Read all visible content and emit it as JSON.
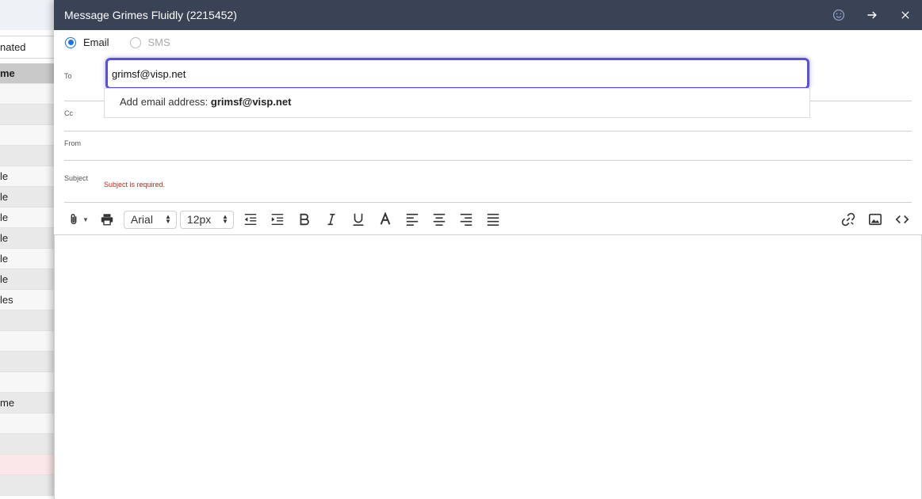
{
  "background": {
    "tab_label": "nated",
    "header_label": "me",
    "rows": [
      {
        "text": "",
        "style": "white"
      },
      {
        "text": "",
        "style": "gray"
      },
      {
        "text": "",
        "style": "white"
      },
      {
        "text": "",
        "style": "gray"
      },
      {
        "text": "le",
        "style": "white"
      },
      {
        "text": "le",
        "style": "gray"
      },
      {
        "text": "le",
        "style": "white"
      },
      {
        "text": "le",
        "style": "gray"
      },
      {
        "text": "le",
        "style": "white"
      },
      {
        "text": "le",
        "style": "gray"
      },
      {
        "text": "les",
        "style": "white"
      },
      {
        "text": "",
        "style": "gray"
      },
      {
        "text": "",
        "style": "white"
      },
      {
        "text": "",
        "style": "gray"
      },
      {
        "text": "",
        "style": "white"
      },
      {
        "text": "me",
        "style": "gray"
      },
      {
        "text": "",
        "style": "white"
      },
      {
        "text": "",
        "style": "gray"
      },
      {
        "text": "",
        "style": "pink"
      },
      {
        "text": "",
        "style": "gray"
      }
    ]
  },
  "dialog": {
    "title": "Message Grimes Fluidly (2215452)",
    "channel": {
      "email_label": "Email",
      "sms_label": "SMS",
      "selected": "Email"
    },
    "fields": {
      "to_label": "To",
      "to_value": "grimsf@visp.net",
      "cc_label": "Cc",
      "from_label": "From",
      "subject_label": "Subject",
      "subject_error": "Subject is required."
    },
    "suggestion": {
      "prefix": "Add email address: ",
      "address": "grimsf@visp.net"
    },
    "toolbar": {
      "font_family": "Arial",
      "font_size": "12px"
    }
  },
  "colors": {
    "titlebar": "#3a4256",
    "focus_ring": "#5b4fe0",
    "radio_accent": "#1a73e8",
    "error": "#d32020"
  }
}
